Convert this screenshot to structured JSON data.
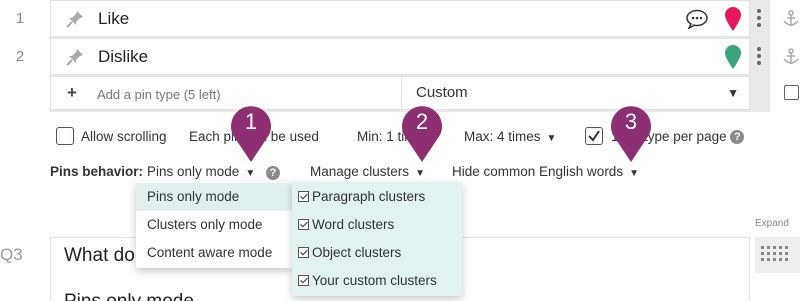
{
  "pins": [
    {
      "number": "1",
      "label": "Like",
      "marker_color": "#e8175d"
    },
    {
      "number": "2",
      "label": "Dislike",
      "marker_color": "#3aa57a"
    }
  ],
  "add_row": {
    "placeholder": "Add a pin type (5 left)",
    "select_value": "Custom"
  },
  "options": {
    "allow_scrolling": "Allow scrolling",
    "each_pin_text": "Each pin can be used",
    "min_label": "Min: 1 time",
    "max_label": "Max: 4 times",
    "type_per_page_label": "1 pin type per page"
  },
  "behavior": {
    "label": "Pins behavior:",
    "selected": "Pins only mode",
    "manage_clusters": "Manage clusters",
    "hide_words": "Hide common English words"
  },
  "behavior_menu": [
    "Pins only mode",
    "Clusters only mode",
    "Content aware mode"
  ],
  "clusters_menu": [
    "Paragraph clusters",
    "Word clusters",
    "Object clusters",
    "Your custom clusters"
  ],
  "expand_label": "Expand",
  "question": {
    "number": "Q3",
    "text": "What do you think about this advertisement?",
    "sub_text": "Pins only mode"
  },
  "callouts": [
    "1",
    "2",
    "3"
  ],
  "colors": {
    "callout": "#8e2f73",
    "menu_highlight": "#e0f0ef"
  }
}
